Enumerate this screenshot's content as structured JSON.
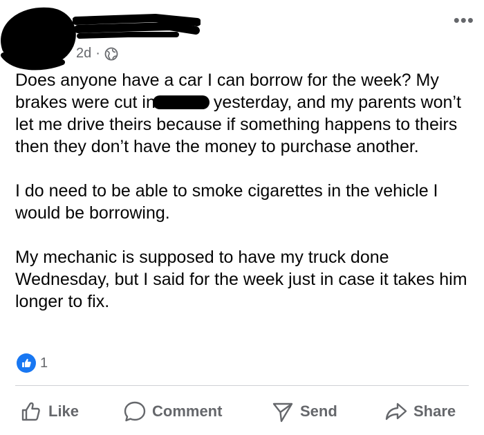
{
  "post": {
    "time": "2d",
    "separator": "·",
    "paragraphs": [
      {
        "before_redaction": "Does anyone have a car I can borrow for the week? My brakes were cut in",
        "after_redaction": "yesterday, and my parents won’t let me drive theirs because if something happens to theirs then they don’t have the money to purchase another."
      },
      "I do need to be able to smoke cigarettes in the vehicle I would be borrowing.",
      "My mechanic is supposed to have my truck done Wednesday, but I said for the week just in case it takes him longer to fix."
    ]
  },
  "reactions": {
    "count": "1"
  },
  "actions": {
    "like": "Like",
    "comment": "Comment",
    "send": "Send",
    "share": "Share"
  },
  "colors": {
    "accent": "#1877f2",
    "secondary_text": "#65676b",
    "divider": "#ced0d4"
  },
  "icons": [
    "globe-icon",
    "more-icon",
    "like-reaction-icon",
    "like-icon",
    "comment-icon",
    "send-icon",
    "share-icon"
  ]
}
